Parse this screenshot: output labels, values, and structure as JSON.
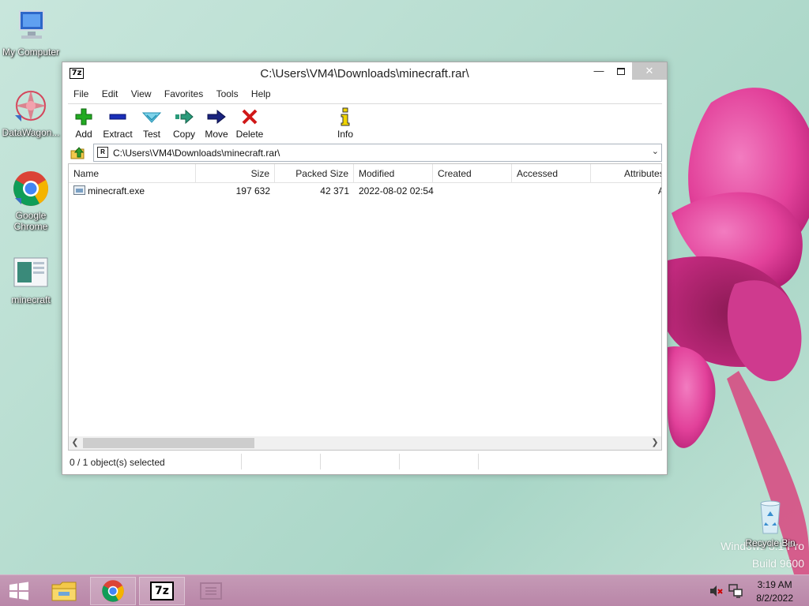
{
  "desktop": {
    "icons": [
      {
        "label": "My Computer",
        "icon": "computer-icon"
      },
      {
        "label": "DataWagon...",
        "icon": "datawagon-icon"
      },
      {
        "label": "Google Chrome",
        "icon": "chrome-icon"
      },
      {
        "label": "minecraft",
        "icon": "image-file-icon"
      },
      {
        "label": "Recycle Bin",
        "icon": "recycle-bin-icon"
      }
    ],
    "watermark": {
      "line1": "Windows 8.1 Pro",
      "line2": "Build 9600"
    }
  },
  "window": {
    "title": "C:\\Users\\VM4\\Downloads\\minecraft.rar\\",
    "app_icon": "7z",
    "controls": {
      "minimize": "—",
      "close": "✕"
    },
    "menu": [
      "File",
      "Edit",
      "View",
      "Favorites",
      "Tools",
      "Help"
    ],
    "toolbar": [
      {
        "label": "Add",
        "icon": "plus-icon",
        "color": "#22aa22"
      },
      {
        "label": "Extract",
        "icon": "minus-icon",
        "color": "#1a2fb8"
      },
      {
        "label": "Test",
        "icon": "check-icon",
        "color": "#2aa7c9"
      },
      {
        "label": "Copy",
        "icon": "double-arrow-icon",
        "color": "#2a9a7a"
      },
      {
        "label": "Move",
        "icon": "arrow-right-icon",
        "color": "#1a237e"
      },
      {
        "label": "Delete",
        "icon": "x-icon",
        "color": "#d01818"
      },
      {
        "label": "Info",
        "icon": "info-icon",
        "color": "#d8b800"
      }
    ],
    "address": {
      "path": "C:\\Users\\VM4\\Downloads\\minecraft.rar\\",
      "icon_text": "R"
    },
    "columns": [
      "Name",
      "Size",
      "Packed Size",
      "Modified",
      "Created",
      "Accessed",
      "Attributes"
    ],
    "rows": [
      {
        "name": "minecraft.exe",
        "size": "197 632",
        "packed": "42 371",
        "modified": "2022-08-02 02:54",
        "created": "",
        "accessed": "",
        "attributes": "A"
      }
    ],
    "status": "0 / 1 object(s) selected"
  },
  "taskbar": {
    "time": "3:19 AM",
    "date": "8/2/2022",
    "items": [
      "start-icon",
      "file-explorer-icon",
      "chrome-icon",
      "7zip-icon",
      "app-icon"
    ]
  },
  "colors": {
    "taskbar": "#bf8fb0",
    "close_button": "#c7c7c7"
  }
}
